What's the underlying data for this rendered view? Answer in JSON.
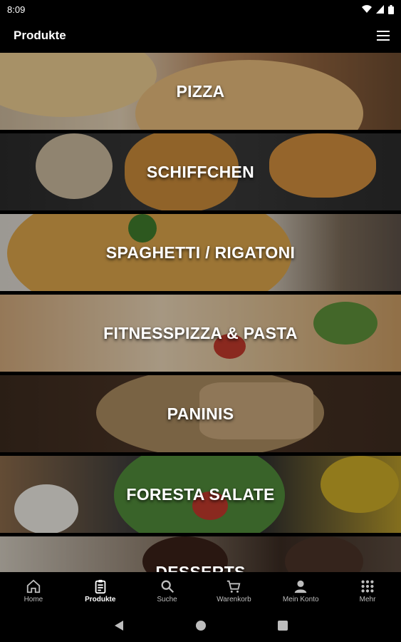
{
  "status": {
    "time": "8:09"
  },
  "appbar": {
    "title": "Produkte"
  },
  "categories": [
    {
      "label": "PIZZA"
    },
    {
      "label": "SCHIFFCHEN"
    },
    {
      "label": "SPAGHETTI / RIGATONI"
    },
    {
      "label": "FITNESSPIZZA & PASTA"
    },
    {
      "label": "PANINIS"
    },
    {
      "label": "FORESTA SALATE"
    },
    {
      "label": "DESSERTS"
    }
  ],
  "nav": {
    "items": [
      {
        "label": "Home",
        "icon": "home-icon"
      },
      {
        "label": "Produkte",
        "icon": "clipboard-icon",
        "active": true
      },
      {
        "label": "Suche",
        "icon": "search-icon"
      },
      {
        "label": "Warenkorb",
        "icon": "cart-icon"
      },
      {
        "label": "Mein Konto",
        "icon": "person-icon"
      },
      {
        "label": "Mehr",
        "icon": "grid-icon"
      }
    ]
  }
}
